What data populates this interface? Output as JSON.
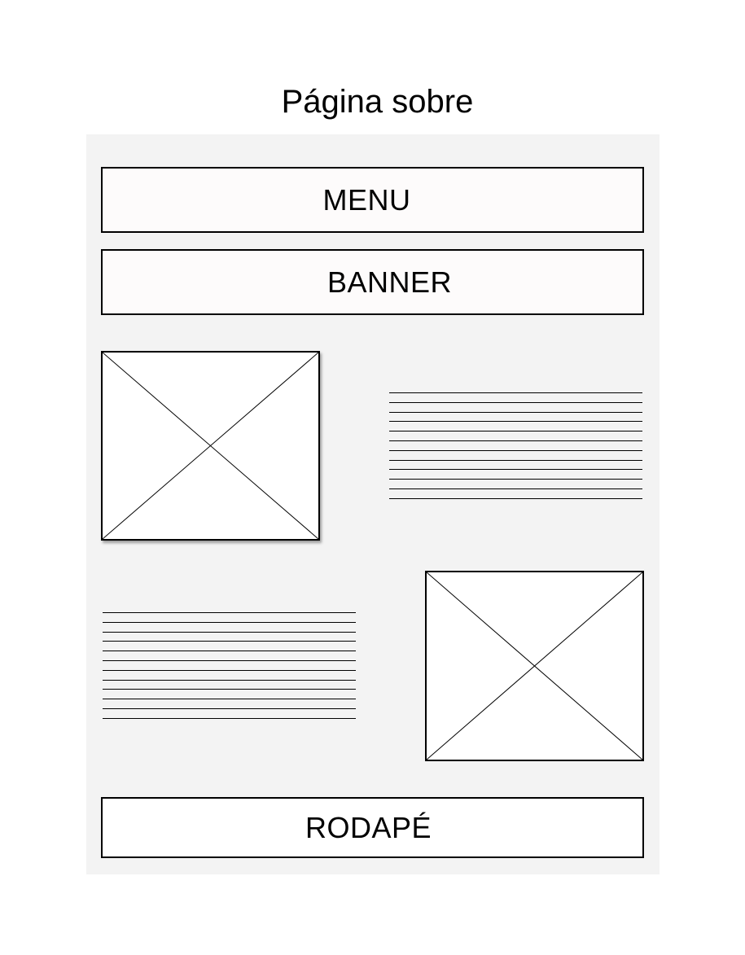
{
  "title": "Página sobre",
  "blocks": {
    "menu": "MENU",
    "banner": "BANNER",
    "footer": "RODAPÉ"
  },
  "text_placeholders": [
    {
      "line_count": 12
    },
    {
      "line_count": 12
    }
  ],
  "colors": {
    "canvas_background": "#f3f3f3",
    "stroke": "#000000",
    "block_fill": "#fdfbfb"
  }
}
